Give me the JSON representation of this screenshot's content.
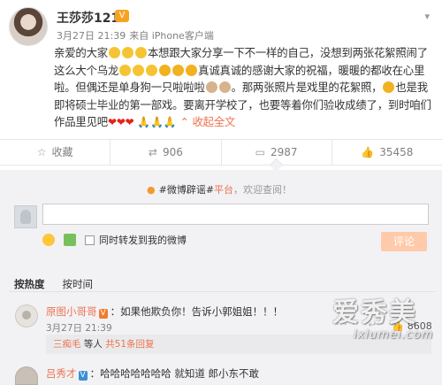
{
  "post": {
    "username": "王莎莎1214",
    "vip_badge": "V",
    "time": "3月27日 21:39",
    "source": "来自 iPhone客户端",
    "lines": [
      [
        "亲爱的大家",
        "本想跟大家分享一下不一样的自己，没想到两张花絮照闹了"
      ],
      [
        "这么大个乌龙",
        "真诚真诚的感谢大家的祝福，暖暖的都收在心里"
      ],
      [
        "啦。但偶还是单身狗一只啦啦啦",
        "。那两张照片是戏里的花絮照，",
        "也是我"
      ],
      [
        "即将硕士毕业的第一部戏。要离开学校了，也要等着你们验收成绩了，到时咱们"
      ],
      [
        "作品里见吧"
      ]
    ],
    "collapse": "收起全文",
    "collapse_icon": "chevron-up-icon",
    "menu_icon": "chevron-down-icon"
  },
  "actions": [
    {
      "icon": "favorite-icon",
      "label": "收藏"
    },
    {
      "icon": "repost-icon",
      "label": "906"
    },
    {
      "icon": "comment-icon",
      "label": "2987"
    },
    {
      "icon": "like-icon",
      "label": "35458"
    }
  ],
  "comments_panel": {
    "notice_prefix": "#微博辟谣#",
    "notice_hot": "平台",
    "notice_suffix": "，欢迎查阅！",
    "forward_label": "同时转发到我的微博",
    "post_button": "评论",
    "sort_hot": "按热度",
    "sort_time": "按时间"
  },
  "comments": [
    {
      "name": "原图小哥哥",
      "badge": "V",
      "text": "：如果他欺负你！告诉小郭姐姐！！！",
      "time": "3月27日 21:39",
      "ops": "··· ↩ ↪",
      "likes": "8608",
      "reply": {
        "name": "三痴毛",
        "middle": " 等人 ",
        "count": "共51条回复"
      }
    },
    {
      "name": "吕秀才",
      "badge": "V",
      "text": "：哈哈哈哈哈哈哈 就知道 郎小东不敢"
    }
  ],
  "watermark": {
    "cn": "爱秀美",
    "en": "ixiumei.com"
  },
  "colors": {
    "accent": "#eb7350",
    "panel": "#f2f2f5",
    "post_button": "#ffcaaa"
  }
}
